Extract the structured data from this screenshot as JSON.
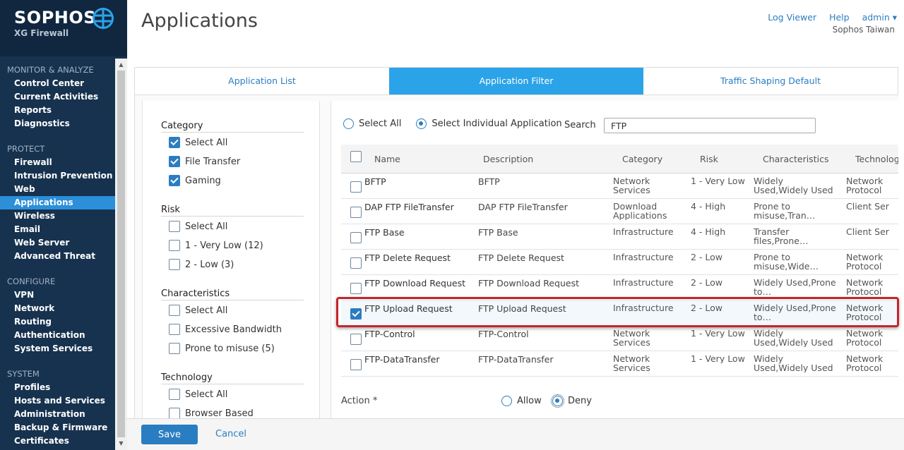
{
  "brand": {
    "name": "SOPHOS",
    "product": "XG Firewall"
  },
  "nav": [
    {
      "section": "MONITOR & ANALYZE",
      "items": [
        "Control Center",
        "Current Activities",
        "Reports",
        "Diagnostics"
      ]
    },
    {
      "section": "PROTECT",
      "items": [
        "Firewall",
        "Intrusion Prevention",
        "Web",
        "Applications",
        "Wireless",
        "Email",
        "Web Server",
        "Advanced Threat"
      ]
    },
    {
      "section": "CONFIGURE",
      "items": [
        "VPN",
        "Network",
        "Routing",
        "Authentication",
        "System Services"
      ]
    },
    {
      "section": "SYSTEM",
      "items": [
        "Profiles",
        "Hosts and Services",
        "Administration",
        "Backup & Firmware",
        "Certificates"
      ]
    }
  ],
  "nav_active": "Applications",
  "header": {
    "title": "Applications",
    "log_viewer": "Log Viewer",
    "help": "Help",
    "user": "admin ▾",
    "org": "Sophos Taiwan"
  },
  "tabs": [
    "Application List",
    "Application Filter",
    "Traffic Shaping Default"
  ],
  "active_tab": 1,
  "filters": {
    "category": {
      "title": "Category",
      "items": [
        {
          "label": "Select All",
          "checked": true
        },
        {
          "label": "File Transfer",
          "checked": true
        },
        {
          "label": "Gaming",
          "checked": true
        }
      ]
    },
    "risk": {
      "title": "Risk",
      "items": [
        {
          "label": "Select All",
          "checked": false
        },
        {
          "label": "1 - Very Low (12)",
          "checked": false
        },
        {
          "label": "2 - Low (3)",
          "checked": false
        }
      ]
    },
    "characteristics": {
      "title": "Characteristics",
      "items": [
        {
          "label": "Select All",
          "checked": false
        },
        {
          "label": "Excessive Bandwidth",
          "checked": false
        },
        {
          "label": "Prone to misuse (5)",
          "checked": false
        }
      ]
    },
    "technology": {
      "title": "Technology",
      "items": [
        {
          "label": "Select All",
          "checked": false
        },
        {
          "label": "Browser Based",
          "checked": false
        }
      ]
    }
  },
  "selection": {
    "select_all": "Select All",
    "select_individual": "Select Individual Application",
    "mode": "individual"
  },
  "search": {
    "label": "Search",
    "value": "FTP"
  },
  "columns": [
    "Name",
    "Description",
    "Category",
    "Risk",
    "Characteristics",
    "Technology"
  ],
  "rows": [
    {
      "name": "BFTP",
      "description": "BFTP",
      "category": "Network Services",
      "risk": "1 - Very Low",
      "characteristics": "Widely Used,Widely Used",
      "technology": "Network Protocol",
      "checked": false
    },
    {
      "name": "DAP FTP FileTransfer",
      "description": "DAP FTP FileTransfer",
      "category": "Download Applications",
      "risk": "4 - High",
      "characteristics": "Prone to misuse,Tran…",
      "technology": "Client Ser",
      "checked": false
    },
    {
      "name": "FTP Base",
      "description": "FTP Base",
      "category": "Infrastructure",
      "risk": "4 - High",
      "characteristics": "Transfer files,Prone…",
      "technology": "Client Ser",
      "checked": false
    },
    {
      "name": "FTP Delete Request",
      "description": "FTP Delete Request",
      "category": "Infrastructure",
      "risk": "2 - Low",
      "characteristics": "Prone to misuse,Wide…",
      "technology": "Network Protocol",
      "checked": false
    },
    {
      "name": "FTP Download Request",
      "description": "FTP Download Request",
      "category": "Infrastructure",
      "risk": "2 - Low",
      "characteristics": "Widely Used,Prone to…",
      "technology": "Network Protocol",
      "checked": false
    },
    {
      "name": "FTP Upload Request",
      "description": "FTP Upload Request",
      "category": "Infrastructure",
      "risk": "2 - Low",
      "characteristics": "Widely Used,Prone to…",
      "technology": "Network Protocol",
      "checked": true
    },
    {
      "name": "FTP-Control",
      "description": "FTP-Control",
      "category": "Network Services",
      "risk": "1 - Very Low",
      "characteristics": "Widely Used,Widely Used",
      "technology": "Network Protocol",
      "checked": false
    },
    {
      "name": "FTP-DataTransfer",
      "description": "FTP-DataTransfer",
      "category": "Network Services",
      "risk": "1 - Very Low",
      "characteristics": "Widely Used,Widely Used",
      "technology": "Network Protocol",
      "checked": false
    }
  ],
  "action": {
    "label": "Action *",
    "allow": "Allow",
    "deny": "Deny",
    "value": "deny"
  },
  "footer": {
    "save": "Save",
    "cancel": "Cancel"
  },
  "colors": {
    "sidebar": "#17324f",
    "accent": "#2b7dc1",
    "tab_active": "#2ba3e8",
    "highlight": "#c3262c"
  }
}
